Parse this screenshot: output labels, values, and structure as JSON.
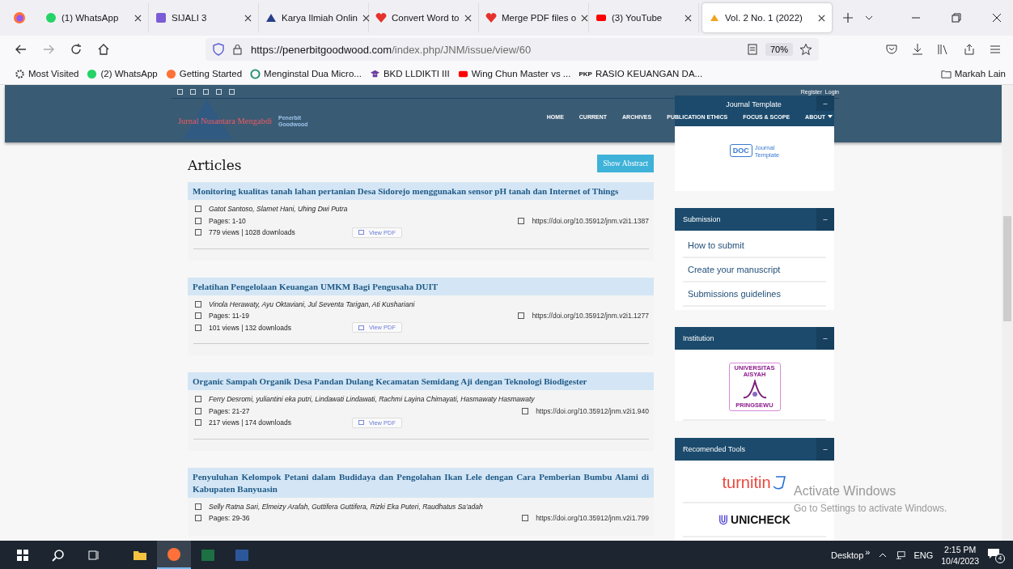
{
  "browser": {
    "tabs": [
      {
        "title": "(1) WhatsApp",
        "selected": false
      },
      {
        "title": "SIJALI 3",
        "selected": false
      },
      {
        "title": "Karya Ilmiah Onlin",
        "selected": false
      },
      {
        "title": "Convert Word to",
        "selected": false
      },
      {
        "title": "Merge PDF files o",
        "selected": false
      },
      {
        "title": "(3) YouTube",
        "selected": false
      },
      {
        "title": "Vol. 2 No. 1 (2022)",
        "selected": true
      }
    ],
    "url_host": "https://penerbitgoodwood.com",
    "url_path": "/index.php/JNM/issue/view/60",
    "zoom": "70%",
    "bookmarks": [
      {
        "label": "Most Visited"
      },
      {
        "label": "(2) WhatsApp"
      },
      {
        "label": "Getting Started"
      },
      {
        "label": "Menginstal Dua Micro..."
      },
      {
        "label": "BKD LLDIKTI III"
      },
      {
        "label": "Wing Chun Master vs ..."
      },
      {
        "label": "RASIO KEUANGAN DA...",
        "icon_text": "PKP"
      }
    ],
    "other_bookmarks": "Markah Lain"
  },
  "header": {
    "top_links": [
      "Register",
      "Login"
    ],
    "journal_name": "Jurnal Nusantara Mengabdi",
    "publisher_lines": [
      "Penerbit",
      "Goodwood"
    ],
    "nav": [
      {
        "label": "HOME",
        "dropdown": false
      },
      {
        "label": "CURRENT",
        "dropdown": false
      },
      {
        "label": "ARCHIVES",
        "dropdown": false
      },
      {
        "label": "PUBLICATION ETHICS",
        "dropdown": false
      },
      {
        "label": "FOCUS & SCOPE",
        "dropdown": false
      },
      {
        "label": "ABOUT",
        "dropdown": true
      }
    ]
  },
  "main": {
    "heading": "Articles",
    "show_abstract": "Show Abstract",
    "articles": [
      {
        "title": "Monitoring kualitas tanah lahan pertanian Desa Sidorejo menggunakan sensor pH tanah dan Internet of Things",
        "authors": "Gatot Santoso, Slamet Hani, Uhing Dwi Putra",
        "pages": "Pages: 1-10",
        "doi": "https://doi.org/10.35912/jnm.v2i1.1387",
        "stats": "779 views | 1028 downloads",
        "pdf": "View PDF"
      },
      {
        "title": "Pelatihan Pengelolaan Keuangan UMKM Bagi Pengusaha DUIT",
        "authors": "Vinola Herawaty, Ayu Oktaviani, Jul Seventa Tarigan, Ati Kushariani",
        "pages": "Pages: 11-19",
        "doi": "https://doi.org/10.35912/jnm.v2i1.1277",
        "stats": "101 views | 132 downloads",
        "pdf": "View PDF"
      },
      {
        "title": "Organic Sampah Organik Desa Pandan Dulang Kecamatan Semidang Aji dengan Teknologi Biodigester",
        "authors": "Ferry Desromi, yuliantini eka putri, Lindawati Lindawati, Rachmi Layina Chimayati, Hasmawaty Hasmawaty",
        "pages": "Pages: 21-27",
        "doi": "https://doi.org/10.35912/jnm.v2i1.940",
        "stats": "217 views | 174 downloads",
        "pdf": "View PDF"
      },
      {
        "title": "Penyuluhan Kelompok Petani dalam Budidaya dan Pengolahan Ikan Lele dengan Cara Pemberian Bumbu Alami di Kabupaten Banyuasin",
        "authors": "Selly Ratna Sari, Elmeizy Arafah, Guttifera Guttifera, Rizki Eka Puteri, Raudhatus Sa'adah",
        "pages": "Pages: 29-36",
        "doi": "https://doi.org/10.35912/jnm.v2i1.799"
      }
    ]
  },
  "sidebar": [
    {
      "title": "Journal Template",
      "toggle": "–",
      "kind": "template",
      "doc": "DOC",
      "lines": [
        "Journal",
        "Template"
      ]
    },
    {
      "title": "Submission",
      "toggle": "–",
      "kind": "links",
      "links": [
        "How to submit",
        "Create your manuscript",
        "Submissions guidelines"
      ]
    },
    {
      "title": "Institution",
      "toggle": "–",
      "kind": "logo",
      "lines": [
        "UNIVERSITAS",
        "AISYAH",
        "PRINGSEWU"
      ]
    },
    {
      "title": "Recomended Tools",
      "toggle": "–",
      "kind": "tools",
      "tools": [
        "turnitin",
        "UNICHECK"
      ]
    }
  ],
  "os_notice": {
    "title": "Activate Windows",
    "text": "Go to Settings to activate Windows."
  },
  "taskbar": {
    "apps": [
      {
        "active": false
      },
      {
        "active": true
      },
      {
        "active": false
      },
      {
        "active": false
      }
    ],
    "desktop": "Desktop",
    "more": "»",
    "lang": "ENG",
    "time": "2:15 PM",
    "date": "10/4/2023",
    "notifications": "4"
  }
}
